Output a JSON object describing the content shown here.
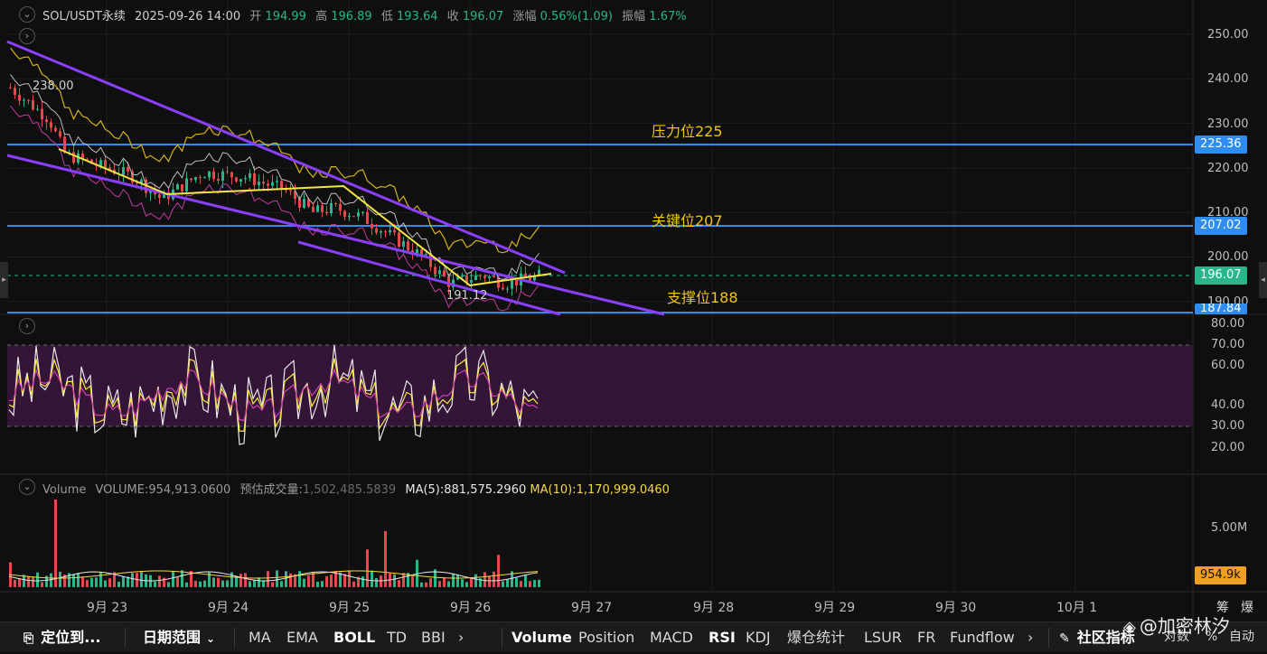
{
  "header": {
    "symbol": "SOL/USDT永续",
    "datetime": "2025-09-26 14:00",
    "open_label": "开",
    "open": "194.99",
    "high_label": "高",
    "high": "196.89",
    "low_label": "低",
    "low": "193.64",
    "close_label": "收",
    "close": "196.07",
    "change_label": "涨幅",
    "change": "0.56%(1.09)",
    "amp_label": "振幅",
    "amp": "1.67%"
  },
  "price_axis": [
    "250.00",
    "240.00",
    "230.00",
    "220.00",
    "210.00",
    "200.00",
    "190.00"
  ],
  "price_tags": {
    "resistance": "225.36",
    "key": "207.02",
    "current": "196.07",
    "support": "187.84"
  },
  "annotations": {
    "resistance": "压力位225",
    "key": "关键位207",
    "support": "支撑位188",
    "high_mark": "238.00",
    "low_mark": "191.12"
  },
  "rsi_axis": [
    "80.00",
    "70.00",
    "60.00",
    "40.00",
    "30.00",
    "20.00"
  ],
  "volume": {
    "label": "Volume",
    "volume_text": "VOLUME:954,913.0600",
    "est_label": "预估成交量:",
    "est_value": "1,502,485.5839",
    "ma5": "MA(5):881,575.2960",
    "ma10": "MA(10):1,170,999.0460",
    "axis_top": "5.00M",
    "current_tag": "954.9k"
  },
  "dates": [
    "9月 23",
    "9月 24",
    "9月 25",
    "9月 26",
    "9月 27",
    "9月 28",
    "9月 29",
    "9月 30",
    "10月 1"
  ],
  "axis_corner": [
    "筹",
    "爆"
  ],
  "toolbar": {
    "locate": "定位到...",
    "date_range": "日期范围",
    "main_indicators": [
      "MA",
      "EMA",
      "BOLL",
      "TD",
      "BBI"
    ],
    "sub_indicators": [
      "Volume",
      "Position",
      "MACD",
      "RSI",
      "KDJ",
      "爆仓统计",
      "LSUR",
      "FR",
      "Fundflow"
    ],
    "community": "社区指标",
    "log": "对数",
    "percent": "%",
    "auto": "自动",
    "watermark": "@加密林汐"
  },
  "colors": {
    "up": "#2bb58a",
    "down": "#e5484d",
    "channel": "#8a3ffc",
    "hline": "#2f8cf0",
    "trend": "#f5e642",
    "annotation": "#f1c40f",
    "rsi_band": "#3b1640"
  }
}
